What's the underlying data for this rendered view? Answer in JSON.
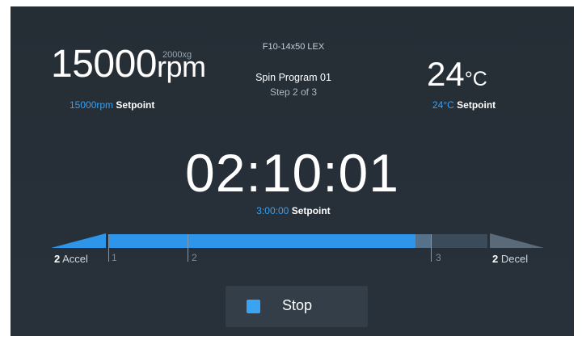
{
  "speed": {
    "value": "15000",
    "unit": "rpm",
    "g_force": "2000xg",
    "setpoint_value": "15000rpm",
    "setpoint_label": "Setpoint"
  },
  "program": {
    "rotor": "F10-14x50 LEX",
    "name": "Spin Program 01",
    "step": "Step 2 of 3"
  },
  "temperature": {
    "value": "24",
    "unit": "°C",
    "setpoint_value": "24°C",
    "setpoint_label": "Setpoint"
  },
  "timer": {
    "value": "02:10:01",
    "setpoint_value": "3:00:00",
    "setpoint_label": "Setpoint"
  },
  "progress": {
    "completed_fraction": 0.81,
    "step2_end_fraction": 0.85,
    "steps": [
      "1",
      "2",
      "3"
    ],
    "accel": {
      "value": "2",
      "label": "Accel"
    },
    "decel": {
      "value": "2",
      "label": "Decel"
    }
  },
  "controls": {
    "stop_label": "Stop"
  },
  "colors": {
    "accent": "#3aa0ef",
    "background": "#262f38",
    "progress_fill": "#2e96ea"
  }
}
